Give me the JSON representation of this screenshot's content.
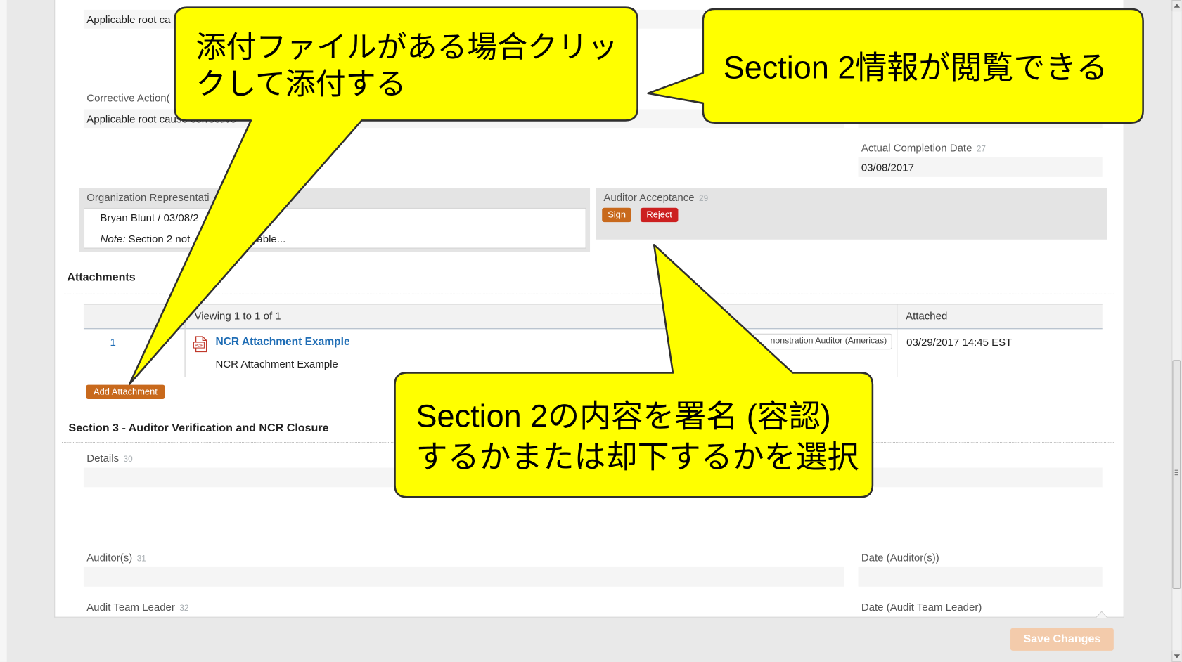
{
  "colors": {
    "page_bg": "#e9e9e9",
    "panel_bg": "#ffffff",
    "field_bg": "#f5f5f5",
    "callout_fill": "#ffff00",
    "callout_stroke": "#2f2f2f",
    "action_orange": "#c8691c",
    "reject_red": "#cc2020",
    "link_blue": "#1f6db5",
    "save_disabled": "#f3cbab"
  },
  "icons": {
    "attachment_file": "pdf-icon",
    "pdf_label": "PDF",
    "scroll_up": "scroll-up-arrow-icon",
    "scroll_down": "scroll-down-arrow-icon",
    "scroll_grip": "scroll-grip-icon"
  },
  "section2": {
    "root_cause_value": "Applicable root ca",
    "corrective_action": {
      "label": "Corrective Action(",
      "value": "Applicable root cause corrective"
    },
    "actual_completion_date": {
      "label": "Actual Completion Date",
      "number": "27",
      "value": "03/08/2017"
    },
    "organization_representative": {
      "label": "Organization Representati",
      "signature": "Bryan Blunt / 03/08/2",
      "note_label": "Note:",
      "note_text": "Section 2 not",
      "note_text_tail": "able..."
    },
    "auditor_acceptance": {
      "label": "Auditor Acceptance",
      "number": "29",
      "sign_label": "Sign",
      "reject_label": "Reject"
    }
  },
  "attachments": {
    "heading": "Attachments",
    "viewing_text": "Viewing 1 to 1 of 1",
    "attached_header": "Attached",
    "rows": [
      {
        "index": "1",
        "icon": "pdf-icon",
        "title": "NCR Attachment Example",
        "description": "NCR Attachment Example",
        "attached_by": "nonstration Auditor (Americas)",
        "attached_at": "03/29/2017 14:45 EST"
      }
    ],
    "add_label": "Add Attachment"
  },
  "section3": {
    "heading": "Section 3 - Auditor Verification and NCR Closure",
    "details": {
      "label": "Details",
      "number": "30"
    },
    "auditors": {
      "label": "Auditor(s)",
      "number": "31"
    },
    "date_auditors": {
      "label": "Date (Auditor(s))"
    },
    "audit_team_leader": {
      "label": "Audit Team Leader",
      "number": "32"
    },
    "date_audit_team_leader": {
      "label": "Date (Audit Team Leader)"
    }
  },
  "footer": {
    "save_label": "Save Changes"
  },
  "callouts": {
    "add_attachment_hint": [
      "添付ファイルがある場合クリッ",
      "クして添付する"
    ],
    "section2_view_hint": [
      "Section 2情報が閲覧できる"
    ],
    "sign_reject_hint": [
      "Section 2の内容を署名 (容認)",
      "するかまたは却下するかを選択"
    ]
  }
}
